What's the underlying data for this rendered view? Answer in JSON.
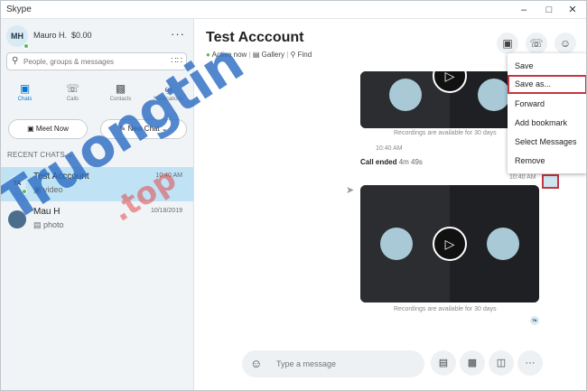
{
  "window": {
    "title": "Skype"
  },
  "profile": {
    "initials": "MH",
    "name": "Mauro H.",
    "balance": "$0.00"
  },
  "search": {
    "placeholder": "People, groups & messages"
  },
  "nav": [
    {
      "label": "Chats"
    },
    {
      "label": "Calls"
    },
    {
      "label": "Contacts"
    },
    {
      "label": "Notifications"
    }
  ],
  "actions": {
    "meet_now": "Meet Now",
    "new_chat": "New Chat"
  },
  "recent": {
    "heading": "RECENT CHATS"
  },
  "chats": [
    {
      "initials": "TA",
      "name": "Test Acccount",
      "time": "10:40 AM",
      "preview": "video"
    },
    {
      "name": "Mau H",
      "time": "10/18/2019",
      "preview": "photo"
    }
  ],
  "conversation": {
    "title": "Test Acccount",
    "status": "Active now",
    "gallery": "Gallery",
    "find": "Find"
  },
  "messages": {
    "recording_note": "Recordings are available for 30 days",
    "time1": "10:40 AM",
    "call_ended_label": "Call ended",
    "call_duration": "4m 49s",
    "time2": "10:40 AM",
    "receipt": "TA"
  },
  "context_menu": [
    "Save",
    "Save as...",
    "Forward",
    "Add bookmark",
    "Select Messages",
    "Remove"
  ],
  "composer": {
    "placeholder": "Type a message"
  },
  "watermark": {
    "text": "Truongtin",
    "suffix": ".top"
  },
  "colors": {
    "accent": "#0078d4",
    "active_chat": "#bfe3f5",
    "highlight": "#c73540",
    "online": "#5cb85c"
  }
}
